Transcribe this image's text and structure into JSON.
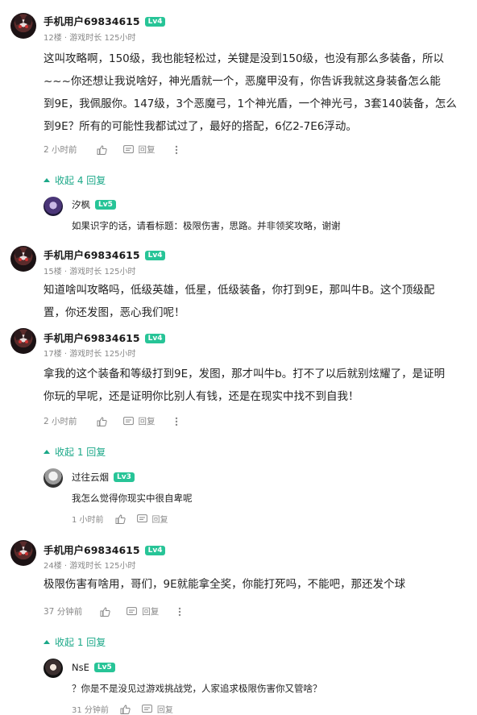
{
  "comments": [
    {
      "user": "手机用户69834615",
      "level": "Lv4",
      "meta": "12楼 · 游戏时长 125小时",
      "lines": [
        "这叫攻略啊，150级，我也能轻松过，关键是没到150级，也没有那么多装备，所以",
        "~~~你还想让我说啥好，神光盾就一个，恶魔甲没有，你告诉我就这身装备怎么能",
        "到9E，我佩服你。147级，3个恶魔弓，1个神光盾，一个神光弓，3套140装备，怎么",
        "到9E？所有的可能性我都试过了，最好的搭配，6亿2-7E6浮动。"
      ],
      "time": "2 小时前",
      "reply_label": "回复",
      "collapse_label": "收起 4 回复",
      "reply": {
        "user": "汐枫",
        "level": "Lv5",
        "text": "如果识字的话，请看标题：极限伤害，思路。并非领奖攻略，谢谢"
      }
    },
    {
      "user": "手机用户69834615",
      "level": "Lv4",
      "meta": "15楼 · 游戏时长 125小时",
      "lines": [
        "知道啥叫攻略吗，低级英雄，低星，低级装备，你打到9E，那叫牛B。这个顶级配",
        "置，你还发图，恶心我们呢！"
      ]
    },
    {
      "user": "手机用户69834615",
      "level": "Lv4",
      "meta": "17楼 · 游戏时长 125小时",
      "lines": [
        "拿我的这个装备和等级打到9E，发图，那才叫牛b。打不了以后就别炫耀了，是证明",
        "你玩的早呢，还是证明你比别人有钱，还是在现实中找不到自我！"
      ],
      "time": "2 小时前",
      "reply_label": "回复",
      "collapse_label": "收起 1 回复",
      "reply": {
        "user": "过往云烟",
        "level": "Lv3",
        "text": "我怎么觉得你现实中很自卑呢",
        "time": "1 小时前",
        "reply_label": "回复"
      }
    },
    {
      "user": "手机用户69834615",
      "level": "Lv4",
      "meta": "24楼 · 游戏时长 125小时",
      "lines": [
        "极限伤害有啥用，哥们，9E就能拿全奖，你能打死吗，不能吧，那还发个球"
      ],
      "time": "37 分钟前",
      "reply_label": "回复",
      "collapse_label": "收起 1 回复",
      "reply": {
        "user": "NsE",
        "level": "Lv5",
        "text": "？你是不是没见过游戏挑战党，人家追求极限伤害你又管啥？",
        "time": "31 分钟前",
        "reply_label": "回复"
      }
    }
  ],
  "colors": {
    "level_badge": "#27c497",
    "collapse_link": "#1ba888",
    "meta": "#888888"
  }
}
